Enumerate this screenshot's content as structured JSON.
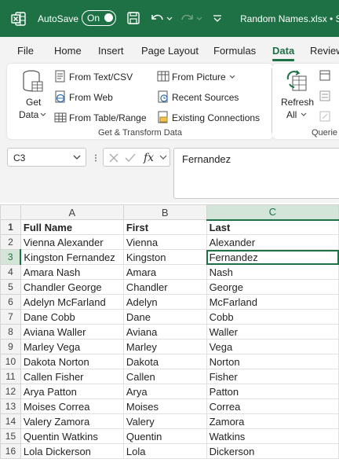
{
  "titlebar": {
    "autosave_label": "AutoSave",
    "toggle_label": "On",
    "filename": "Random Names.xlsx  •  S"
  },
  "tabs": [
    "File",
    "Home",
    "Insert",
    "Page Layout",
    "Formulas",
    "Data",
    "Review"
  ],
  "active_tab": "Data",
  "ribbon": {
    "get_data": {
      "line1": "Get",
      "line2": "Data"
    },
    "col1": [
      "From Text/CSV",
      "From Web",
      "From Table/Range"
    ],
    "col2": [
      "From Picture",
      "Recent Sources",
      "Existing Connections"
    ],
    "group_label": "Get & Transform Data",
    "refresh": {
      "line1": "Refresh",
      "line2": "All"
    },
    "group2_label": "Querie"
  },
  "formula_bar": {
    "name_box": "C3",
    "formula": "Fernandez"
  },
  "sheet": {
    "columns": [
      "A",
      "B",
      "C"
    ],
    "selected_column": "C",
    "active_row": 3,
    "rows": [
      [
        "Full Name",
        "First",
        "Last"
      ],
      [
        "Vienna Alexander",
        "Vienna",
        "Alexander"
      ],
      [
        "Kingston Fernandez",
        "Kingston",
        "Fernandez"
      ],
      [
        "Amara Nash",
        "Amara",
        "Nash"
      ],
      [
        "Chandler George",
        "Chandler",
        "George"
      ],
      [
        "Adelyn McFarland",
        "Adelyn",
        "McFarland"
      ],
      [
        "Dane Cobb",
        "Dane",
        "Cobb"
      ],
      [
        "Aviana Waller",
        "Aviana",
        "Waller"
      ],
      [
        "Marley Vega",
        "Marley",
        "Vega"
      ],
      [
        "Dakota Norton",
        "Dakota",
        "Norton"
      ],
      [
        "Callen Fisher",
        "Callen",
        "Fisher"
      ],
      [
        "Arya Patton",
        "Arya",
        "Patton"
      ],
      [
        "Moises Correa",
        "Moises",
        "Correa"
      ],
      [
        "Valery Zamora",
        "Valery",
        "Zamora"
      ],
      [
        "Quentin Watkins",
        "Quentin",
        "Watkins"
      ],
      [
        "Lola Dickerson",
        "Lola",
        "Dickerson"
      ]
    ]
  },
  "colors": {
    "excel_green": "#1e7145",
    "header_bg": "#f3f3f3",
    "selected_header_bg": "#d3e4d8"
  }
}
